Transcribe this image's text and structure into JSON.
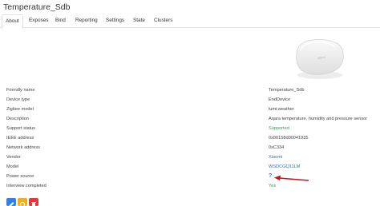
{
  "page": {
    "title": "Temperature_Sdb"
  },
  "tabs": [
    "About",
    "Exposes",
    "Bind",
    "Reporting",
    "Settings",
    "State",
    "Clusters"
  ],
  "active_tab": "About",
  "device_image": {
    "alt_icon": "aqara-sensor-device-image",
    "brand_mark": "aqara"
  },
  "details": {
    "friendly_name": {
      "label": "Friendly name",
      "value": "Temperature_Sdb"
    },
    "device_type": {
      "label": "Device type",
      "value": "EndDevice"
    },
    "zigbee_model": {
      "label": "Zigbee model",
      "value": "lumi.weather"
    },
    "description": {
      "label": "Description",
      "value": "Aqara temperature, humidity and pressure sensor"
    },
    "support_status": {
      "label": "Support status",
      "value": "Supported"
    },
    "ieee_address": {
      "label": "IEEE address",
      "value": "0x00158d00041935"
    },
    "network_address": {
      "label": "Network address",
      "value": "0xC334"
    },
    "vendor": {
      "label": "Vendor",
      "value": "Xiaomi"
    },
    "model": {
      "label": "Model",
      "value": "WSDCGQ11LM"
    },
    "power_source": {
      "label": "Power source",
      "value": "?"
    },
    "interview_completed": {
      "label": "Interview completed",
      "value": "Yes"
    }
  },
  "colors": {
    "supported": "#28a745",
    "link": "#2a6fdb",
    "arrow": "#c0141c",
    "btn_edit": "#2f80ed",
    "btn_reconfigure": "#f0ad1e",
    "btn_remove": "#e03a3a"
  },
  "action_buttons": [
    {
      "icon": "edit-icon"
    },
    {
      "icon": "reconfigure-icon"
    },
    {
      "icon": "remove-icon"
    }
  ]
}
